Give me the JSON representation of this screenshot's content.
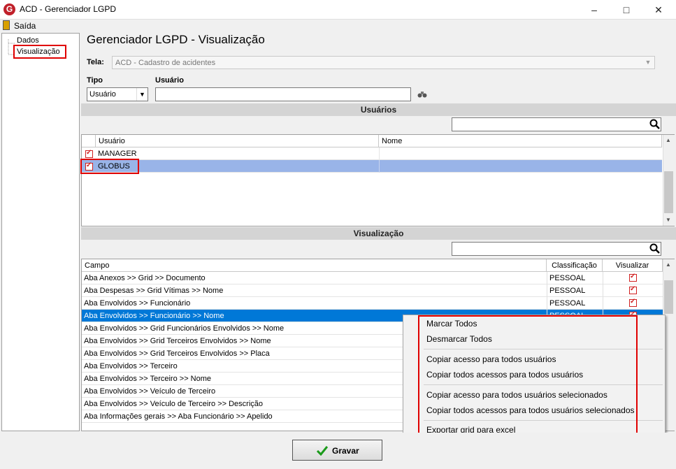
{
  "window": {
    "logo_letter": "G",
    "title": "ACD - Gerenciador LGPD",
    "minimize": "–",
    "maximize": "□",
    "close": "✕"
  },
  "menu": {
    "exit_label": "Saída"
  },
  "tree": {
    "items": [
      "Dados",
      "Visualização"
    ]
  },
  "page": {
    "title": "Gerenciador LGPD - Visualização",
    "tela_label": "Tela:",
    "tela_value": "ACD - Cadastro de acidentes",
    "tipo_label": "Tipo",
    "tipo_value": "Usuário",
    "usuario_label": "Usuário"
  },
  "users_section": {
    "header": "Usuários",
    "columns": [
      "Usuário",
      "Nome"
    ],
    "rows": [
      {
        "usuario": "MANAGER",
        "nome": "",
        "checked": true
      },
      {
        "usuario": "GLOBUS",
        "nome": "",
        "checked": true
      }
    ]
  },
  "vis_section": {
    "header": "Visualização",
    "columns": [
      "Campo",
      "Classificação",
      "Visualizar"
    ],
    "rows": [
      {
        "campo": "Aba Anexos >> Grid >> Documento",
        "classificacao": "PESSOAL",
        "visualizar": true
      },
      {
        "campo": "Aba Despesas >> Grid Vítimas >> Nome",
        "classificacao": "PESSOAL",
        "visualizar": true
      },
      {
        "campo": "Aba Envolvidos >> Funcionário",
        "classificacao": "PESSOAL",
        "visualizar": true
      },
      {
        "campo": "Aba Envolvidos >> Funcionário >> Nome",
        "classificacao": "PESSOAL",
        "visualizar": true
      },
      {
        "campo": "Aba Envolvidos >> Grid Funcionários Envolvidos >> Nome",
        "classificacao": "",
        "visualizar": false
      },
      {
        "campo": "Aba Envolvidos >> Grid Terceiros Envolvidos >> Nome",
        "classificacao": "",
        "visualizar": false
      },
      {
        "campo": "Aba Envolvidos >> Grid Terceiros Envolvidos >> Placa",
        "classificacao": "",
        "visualizar": false
      },
      {
        "campo": "Aba Envolvidos >> Terceiro",
        "classificacao": "",
        "visualizar": false
      },
      {
        "campo": "Aba Envolvidos >> Terceiro >> Nome",
        "classificacao": "",
        "visualizar": false
      },
      {
        "campo": "Aba Envolvidos >> Veículo de Terceiro",
        "classificacao": "",
        "visualizar": false
      },
      {
        "campo": "Aba Envolvidos >> Veículo de Terceiro >> Descrição",
        "classificacao": "",
        "visualizar": false
      },
      {
        "campo": "Aba Informações gerais >> Aba Funcionário >> Apelido",
        "classificacao": "",
        "visualizar": false
      }
    ]
  },
  "context_menu": {
    "items": [
      "Marcar Todos",
      "Desmarcar Todos",
      "Copiar acesso para todos usuários",
      "Copiar todos acessos para todos usuários",
      "Copiar acesso para todos usuários selecionados",
      "Copiar todos acessos para todos usuários selecionados",
      "Exportar grid para excel"
    ]
  },
  "footer": {
    "gravar_label": "Gravar"
  },
  "colors": {
    "selection": "#0078d7",
    "highlight_red": "#e00000",
    "light_selection": "#99b4e8"
  }
}
